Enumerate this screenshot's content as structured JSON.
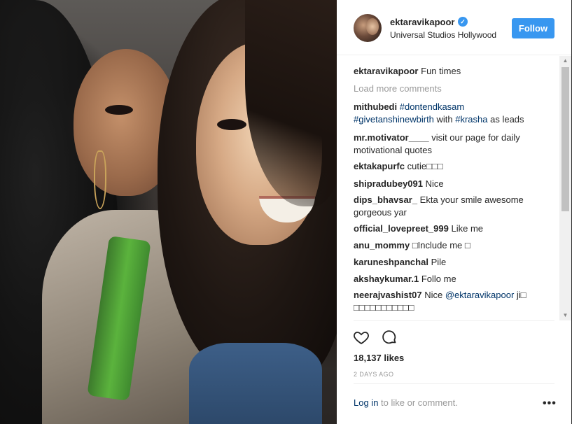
{
  "post": {
    "username": "ektaravikapoor",
    "verified_glyph": "✓",
    "location": "Universal Studios Hollywood",
    "follow_label": "Follow",
    "caption": {
      "user": "ektaravikapoor",
      "text": "Fun times"
    },
    "load_more": "Load more comments",
    "comments": [
      {
        "user": "mithubedi",
        "parts": [
          {
            "t": "#dontendkasam",
            "tag": true
          },
          {
            "t": "\n",
            "tag": false
          },
          {
            "t": "#givetanshinewbirth",
            "tag": true
          },
          {
            "t": " with ",
            "tag": false
          },
          {
            "t": "#krasha",
            "tag": true
          },
          {
            "t": " as leads",
            "tag": false
          }
        ]
      },
      {
        "user": "mr.motivator____",
        "parts": [
          {
            "t": "visit our page for daily motivational quotes",
            "tag": false
          }
        ]
      },
      {
        "user": "ektakapurfc",
        "parts": [
          {
            "t": "cutie□□□",
            "tag": false
          }
        ]
      },
      {
        "user": "shipradubey091",
        "parts": [
          {
            "t": "Nice",
            "tag": false
          }
        ]
      },
      {
        "user": "dips_bhavsar_",
        "parts": [
          {
            "t": "Ekta your smile awesome gorgeous yar",
            "tag": false
          }
        ]
      },
      {
        "user": "official_lovepreet_999",
        "parts": [
          {
            "t": "Like me",
            "tag": false
          }
        ]
      },
      {
        "user": "anu_mommy",
        "parts": [
          {
            "t": "□Include me □",
            "tag": false
          }
        ]
      },
      {
        "user": "karuneshpanchal",
        "parts": [
          {
            "t": "Pile",
            "tag": false
          }
        ]
      },
      {
        "user": "akshaykumar.1",
        "parts": [
          {
            "t": "Follo me",
            "tag": false
          }
        ]
      },
      {
        "user": "neerajvashist07",
        "parts": [
          {
            "t": "Nice ",
            "tag": false
          },
          {
            "t": "@ektaravikapoor",
            "tag": true
          },
          {
            "t": " ji□\n□□□□□□□□□□□",
            "tag": false
          }
        ]
      }
    ],
    "likes": "18,137 likes",
    "time": "2 DAYS AGO",
    "login_link": "Log in",
    "login_rest": " to like or comment.",
    "more_glyph": "•••",
    "scroll_up_glyph": "▲",
    "scroll_down_glyph": "▼"
  },
  "icons": {
    "heart": "heart-outline-icon",
    "comment": "comment-bubble-icon",
    "more": "ellipsis-icon"
  }
}
